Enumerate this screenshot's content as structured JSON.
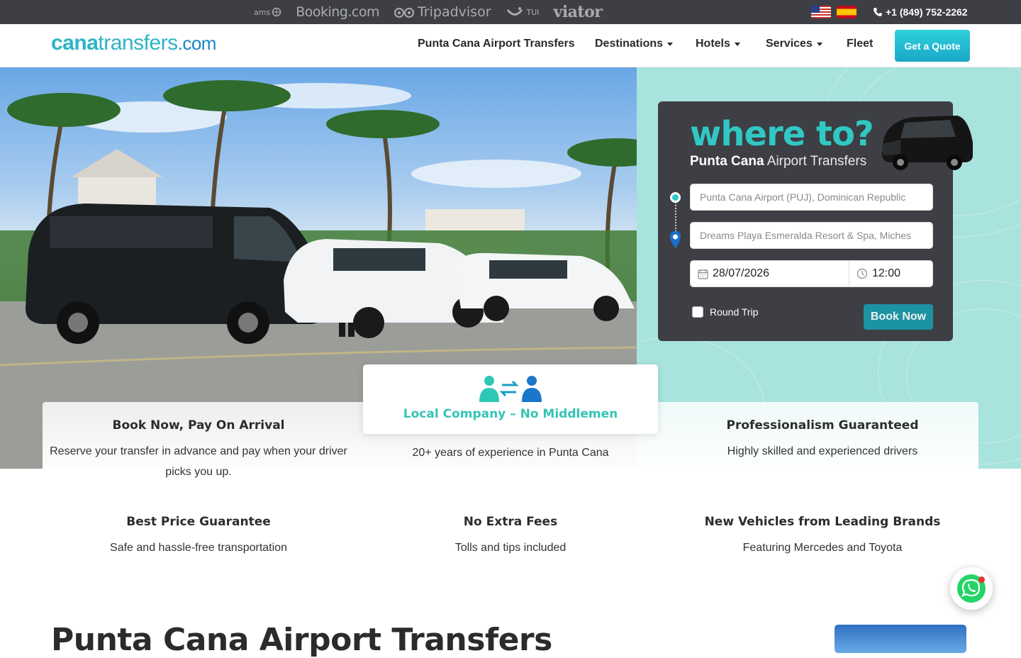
{
  "topbar": {
    "partners": [
      "ams",
      "Booking.com",
      "Tripadvisor",
      "TUI",
      "viator"
    ],
    "phone": "+1 (849) 752-2262"
  },
  "header": {
    "logo": {
      "part1": "cana",
      "part2": "transfers",
      "part3": ".com"
    },
    "nav": [
      {
        "label": "Punta Cana Airport Transfers"
      },
      {
        "label": "Destinations"
      },
      {
        "label": "Hotels"
      },
      {
        "label": "Services"
      },
      {
        "label": "Fleet"
      }
    ],
    "cta_label": "Get a Quote"
  },
  "booking": {
    "title": "where to?",
    "subtitle_bold": "Punta Cana",
    "subtitle_light": "Airport Transfers",
    "from_placeholder": "Punta Cana Airport (PUJ), Dominican Republic",
    "to_placeholder": "Dreams Playa Esmeralda Resort & Spa, Miches",
    "date_value": "28/07/2026",
    "time_value": "12:00",
    "round_trip_label": "Round Trip",
    "book_label": "Book Now"
  },
  "features": [
    {
      "title": "Book Now, Pay On Arrival",
      "text": "Reserve your transfer in advance and pay when your driver picks you up."
    },
    {
      "title": "Local Company – No Middlemen",
      "text": "20+ years of experience in Punta Cana"
    },
    {
      "title": "Professionalism Guaranteed",
      "text": "Highly skilled and experienced drivers"
    },
    {
      "title": "Best Price Guarantee",
      "text": "Safe and hassle-free transportation"
    },
    {
      "title": "No Extra Fees",
      "text": "Tolls and tips included"
    },
    {
      "title": "New Vehicles from Leading Brands",
      "text": "Featuring Mercedes and Toyota"
    }
  ],
  "section": {
    "title": "Punta Cana Airport Transfers"
  },
  "colors": {
    "accent": "#2bb5c4",
    "dark_panel": "#3d3f44",
    "button": "#1c93a3",
    "side_bg": "#a9e3de"
  }
}
